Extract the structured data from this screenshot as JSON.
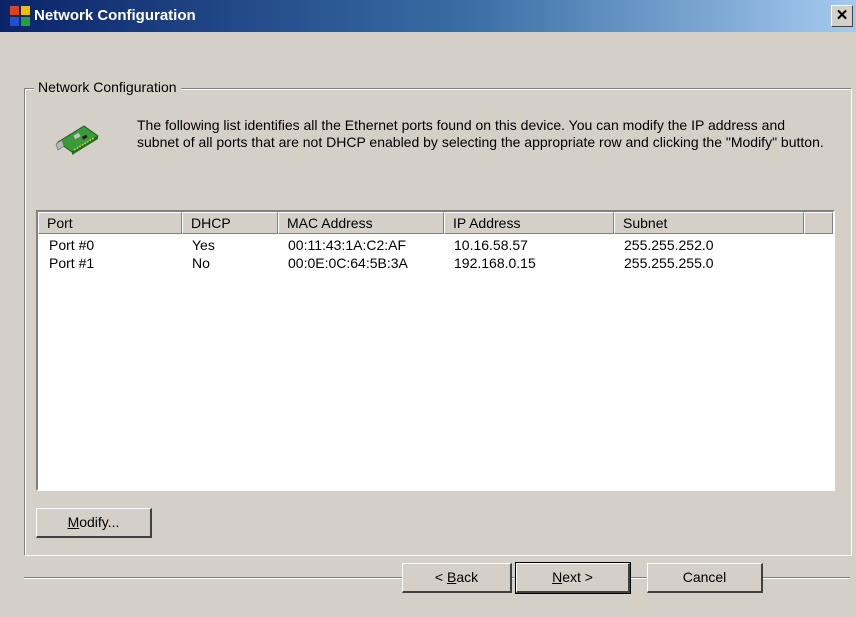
{
  "window": {
    "title": "Network Configuration",
    "close_glyph": "✕",
    "icon": "network-config-app-icon"
  },
  "group": {
    "legend": "Network Configuration",
    "icon": "network-card-icon",
    "description": "The following list identifies all the Ethernet ports found on this device. You can modify the IP address and subnet of all ports that are not DHCP enabled by selecting the appropriate row and clicking the \"Modify\" button."
  },
  "table": {
    "columns": [
      "Port",
      "DHCP",
      "MAC Address",
      "IP Address",
      "Subnet"
    ],
    "rows": [
      [
        "Port #0",
        "Yes",
        "00:11:43:1A:C2:AF",
        "10.16.58.57",
        "255.255.252.0"
      ],
      [
        "Port #1",
        "No",
        "00:0E:0C:64:5B:3A",
        "192.168.0.15",
        "255.255.255.0"
      ]
    ]
  },
  "buttons": {
    "modify": {
      "mnemonic": "M",
      "rest": "odify..."
    },
    "back": {
      "prefix": "< ",
      "mnemonic": "B",
      "rest": "ack"
    },
    "next": {
      "mnemonic": "N",
      "rest": "ext >"
    },
    "cancel": "Cancel"
  },
  "colors": {
    "face": "#d4d0c8",
    "title_start": "#0a246a",
    "title_end": "#a6caf0"
  }
}
